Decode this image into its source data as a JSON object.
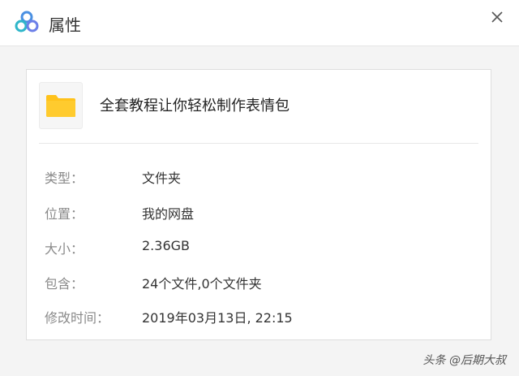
{
  "window": {
    "title": "属性"
  },
  "file": {
    "name": "全套教程让你轻松制作表情包",
    "icon": "folder-icon"
  },
  "properties": [
    {
      "label": "类型：",
      "value": "文件夹"
    },
    {
      "label": "位置：",
      "value": "我的网盘"
    },
    {
      "label": "大小：",
      "value": "2.36GB"
    },
    {
      "label": "包含：",
      "value": "24个文件,0个文件夹"
    },
    {
      "label": "修改时间：",
      "value": "2019年03月13日, 22:15"
    }
  ],
  "watermark": "头条 @后期大叔",
  "colors": {
    "folder": "#ffc21a",
    "label": "#8a8a8a",
    "logo": "#4a90e2"
  }
}
